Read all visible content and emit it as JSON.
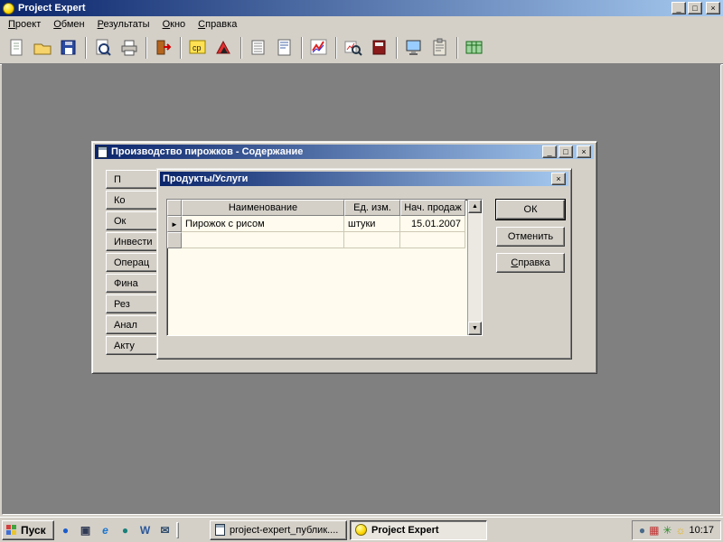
{
  "app": {
    "title": "Project Expert",
    "window_controls": {
      "minimize": "_",
      "maximize": "□",
      "close": "×"
    }
  },
  "menu": {
    "items": [
      {
        "label": "Проект"
      },
      {
        "label": "Обмен"
      },
      {
        "label": "Результаты"
      },
      {
        "label": "Окно"
      },
      {
        "label": "Справка"
      }
    ]
  },
  "toolbar": {
    "icons": [
      {
        "name": "new-project-icon"
      },
      {
        "name": "open-project-icon"
      },
      {
        "name": "save-project-icon"
      },
      {
        "name": "print-preview-icon"
      },
      {
        "name": "print-icon"
      },
      {
        "name": "exit-icon"
      },
      {
        "name": "currencies-icon"
      },
      {
        "name": "inflation-icon"
      },
      {
        "name": "taxes-list-icon"
      },
      {
        "name": "text-description-icon"
      },
      {
        "name": "chart-icon"
      },
      {
        "name": "analysis-icon"
      },
      {
        "name": "report-icon"
      },
      {
        "name": "screen-icon"
      },
      {
        "name": "clipboard-icon"
      },
      {
        "name": "cash-flow-table-icon"
      }
    ]
  },
  "mdi_window": {
    "title": "Производство пирожков - Содержание",
    "controls": {
      "minimize": "_",
      "restore": "□",
      "close": "×"
    },
    "side_buttons": [
      "П",
      "Ко",
      "Ок",
      "Инвести",
      "Операц",
      "Фина",
      "Рез",
      "Анал",
      "Акту"
    ]
  },
  "dialog": {
    "title": "Продукты/Услуги",
    "close": "×",
    "table": {
      "headers": [
        "Наименование",
        "Ед. изм.",
        "Нач. продаж"
      ],
      "row_marker": "►",
      "rows": [
        {
          "name": "Пирожок с рисом",
          "unit": "штуки",
          "start": "15.01.2007"
        }
      ]
    },
    "scrollbar": {
      "up": "▲",
      "down": "▼"
    },
    "buttons": {
      "ok": "ОК",
      "cancel": "Отменить",
      "help": "Справка"
    }
  },
  "taskbar": {
    "start_label": "Пуск",
    "quicklaunch": [
      {
        "name": "quicklaunch-internet-icon",
        "glyph": "●"
      },
      {
        "name": "quicklaunch-save-icon",
        "glyph": "▣"
      },
      {
        "name": "quicklaunch-ie-icon",
        "glyph": "e"
      },
      {
        "name": "quicklaunch-globe-icon",
        "glyph": "●"
      },
      {
        "name": "quicklaunch-word-icon",
        "glyph": "W"
      },
      {
        "name": "quicklaunch-mail-icon",
        "glyph": "✉"
      }
    ],
    "tasks": [
      {
        "label": "project-expert_публик...."
      },
      {
        "label": "Project Expert"
      }
    ],
    "tray_icons": [
      {
        "name": "tray-icon-1",
        "glyph": "●"
      },
      {
        "name": "tray-icon-2",
        "glyph": "▦"
      },
      {
        "name": "tray-icon-3",
        "glyph": "✳"
      },
      {
        "name": "tray-icon-4",
        "glyph": "☼"
      }
    ],
    "clock": "10:17"
  },
  "colors": {
    "titlebar_start": "#0a246a",
    "titlebar_end": "#a6caf0",
    "face": "#d4d0c8",
    "workspace": "#808080",
    "table_bg": "#fffbee"
  }
}
